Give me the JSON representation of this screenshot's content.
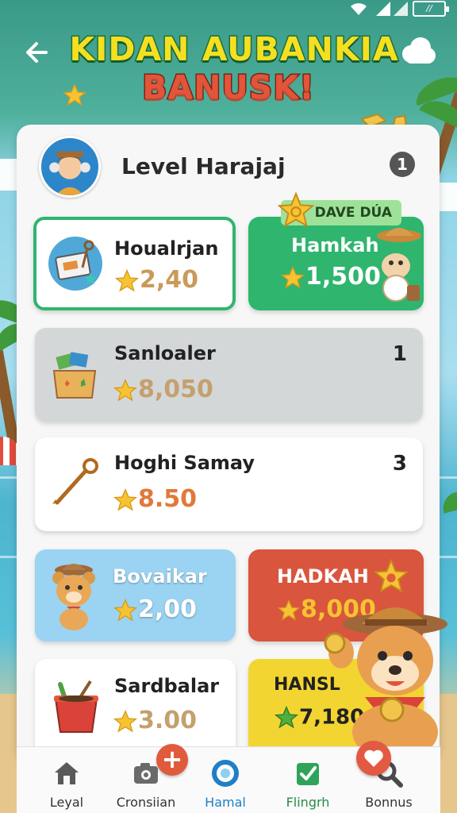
{
  "header": {
    "title_line1": "KIDAN AUBANKIA",
    "title_line2": "BANUSK!"
  },
  "status": {
    "battery_label": "//"
  },
  "profile": {
    "level_label": "Level Harajaj",
    "info_badge": "1"
  },
  "ribbon": {
    "label": "DAVE DÚA"
  },
  "cards": [
    {
      "name": "Houalrjan",
      "value": "2,40"
    },
    {
      "name": "Hamkah",
      "value": "1,500"
    },
    {
      "name": "Sanloaler",
      "value": "8,050",
      "count": "1"
    },
    {
      "name": "Hoghi Samay",
      "value": "8.50",
      "count": "3"
    },
    {
      "name": "Bovaikar",
      "value": "2,00"
    },
    {
      "name": "HADKAH",
      "value": "8,000"
    },
    {
      "name": "Sardbalar",
      "value": "3.00"
    },
    {
      "name": "HANSL",
      "value": "7,180"
    }
  ],
  "nav": [
    {
      "label": "Leyal",
      "icon": "home-icon"
    },
    {
      "label": "Cronsiian",
      "icon": "camera-icon"
    },
    {
      "label": "Hamal",
      "icon": "ring-icon"
    },
    {
      "label": "Flingrh",
      "icon": "checklist-icon"
    },
    {
      "label": "Bonnus",
      "icon": "search-icon"
    }
  ],
  "colors": {
    "accent_green": "#2fb56e",
    "accent_red": "#d9553d",
    "accent_blue": "#9bd3f2",
    "accent_yellow": "#f3d531",
    "value_orange": "#d58a3e",
    "value_tan": "#c4a06e"
  }
}
